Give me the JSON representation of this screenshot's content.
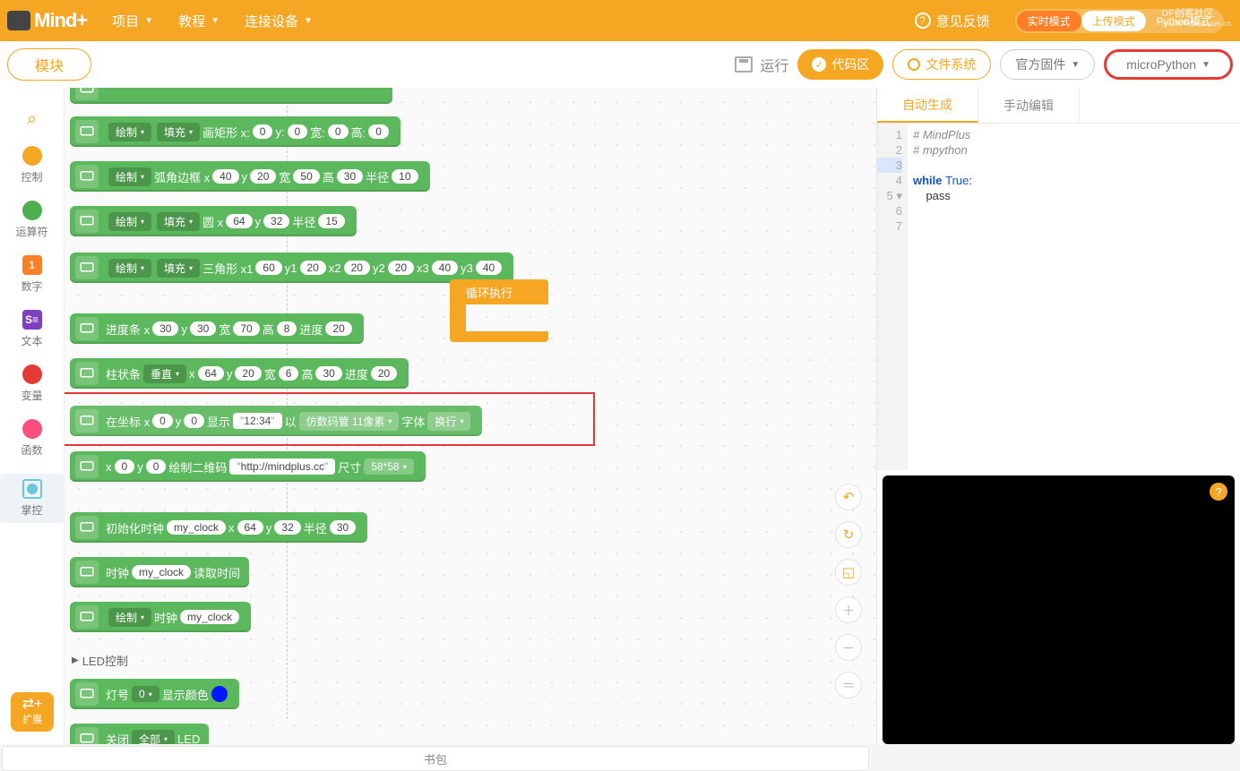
{
  "menubar": {
    "logo": "Mind+",
    "items": [
      "项目",
      "教程",
      "连接设备"
    ],
    "feedback": "意见反馈",
    "modes": {
      "realtime": "实时模式",
      "upload": "上传模式",
      "python": "Python模式"
    },
    "watermark": {
      "main": "DF创客社区",
      "sub": "mc.DFRobot.com.cn"
    }
  },
  "toolbar": {
    "blocks": "模块",
    "run": "运行",
    "codearea": "代码区",
    "filesys": "文件系统",
    "firmware": "官方固件",
    "language": "microPython"
  },
  "categories": {
    "search": "",
    "control": "控制",
    "operators": "运算符",
    "number": "数字",
    "text": "文本",
    "variables": "变量",
    "functions": "函数",
    "board": "掌控",
    "extend": "扩展"
  },
  "blocks": {
    "draw": "绘制",
    "fill": "填充",
    "rect": "画矩形 x:",
    "y": "y:",
    "w": "宽:",
    "h": "高:",
    "roundrect": "弧角边框 x",
    "yl": "y",
    "wl": "宽",
    "hl": "高",
    "rl": "半径",
    "circle": "圆 x",
    "triangle": "三角形 x1",
    "y1": "y1",
    "x2": "x2",
    "y2": "y2",
    "x3": "x3",
    "y3": "y3",
    "progress": "进度条 x",
    "prog": "进度",
    "bar": "柱状条",
    "vertical": "垂直",
    "x": "x",
    "coord": "在坐标 x",
    "show": "显示",
    "time": "12:34",
    "as": "以",
    "font": "仿数码管 11像素",
    "fontlbl": "字体",
    "wrap": "换行",
    "qr": "绘制二维码",
    "url": "http://mindplus.cc",
    "size": "尺寸",
    "sizeval": "58*58",
    "initclock": "初始化时钟",
    "clockname": "my_clock",
    "radius": "半径",
    "clock": "时钟",
    "readtime": "读取时间",
    "ledhdr": "LED控制",
    "lednum": "灯号",
    "showcolor": "显示颜色",
    "ledgroup": "关闭",
    "all": "全部",
    "led": "LED",
    "loop": "循环执行",
    "v": {
      "z": "0",
      "z2": "0",
      "z3": "0",
      "z4": "0",
      "z5": "0",
      "a40": "40",
      "a20": "20",
      "a50": "50",
      "a30": "30",
      "a10": "10",
      "a64": "64",
      "a32": "32",
      "a15": "15",
      "a60": "60",
      "a70": "70",
      "a8": "8",
      "a6": "6",
      "zero": "0"
    }
  },
  "code_tabs": {
    "auto": "自动生成",
    "manual": "手动编辑"
  },
  "code": {
    "l1": "# MindPlus",
    "l2": "# mpython",
    "l3": "",
    "l4": "",
    "l5a": "while ",
    "l5b": "True",
    "l5c": ":",
    "l6": "    pass",
    "l7": ""
  },
  "footer": {
    "backpack": "书包"
  }
}
